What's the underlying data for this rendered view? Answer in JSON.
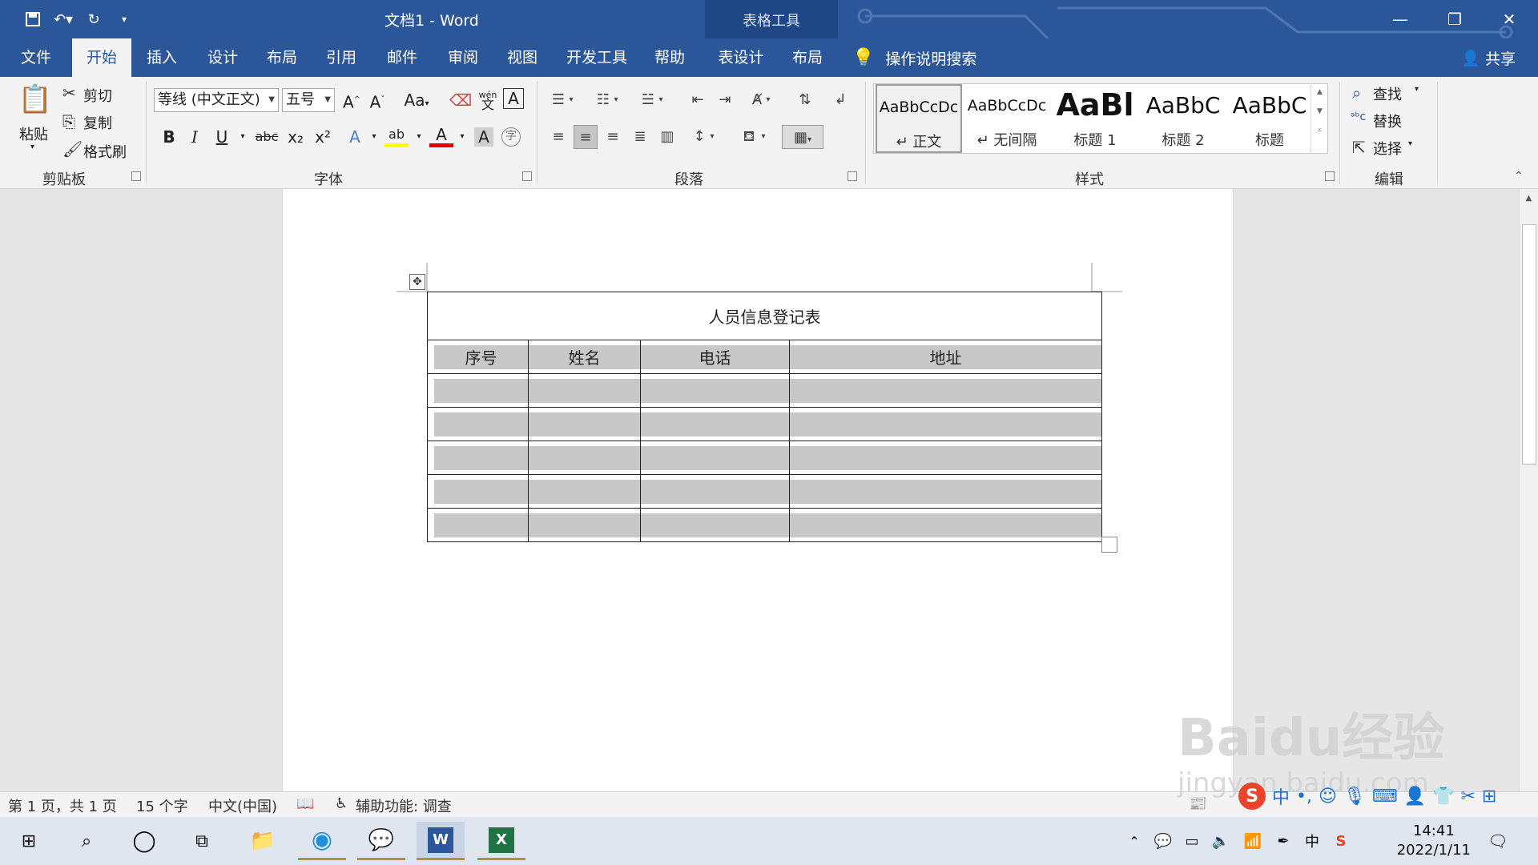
{
  "titlebar": {
    "doc_title": "文档1  -  Word",
    "tools_label": "表格工具"
  },
  "tabs": [
    "文件",
    "开始",
    "插入",
    "设计",
    "布局",
    "引用",
    "邮件",
    "审阅",
    "视图",
    "开发工具",
    "帮助",
    "表设计",
    "布局"
  ],
  "active_tab": "开始",
  "search": {
    "label": "操作说明搜索"
  },
  "share": {
    "label": "共享"
  },
  "clipboard": {
    "paste": "粘贴",
    "cut": "剪切",
    "copy": "复制",
    "format_painter": "格式刷",
    "label": "剪贴板"
  },
  "font": {
    "family": "等线 (中文正文)",
    "size": "五号",
    "label": "字体",
    "bold": "B",
    "italic": "I",
    "underline": "U",
    "strike": "abc",
    "grow": "A",
    "shrink": "A",
    "case": "Aa",
    "sub": "x₂",
    "sup": "x²",
    "effects": "A",
    "highlight": "ab",
    "color": "A",
    "shade": "A",
    "char_border": "A",
    "phonetic": "wén",
    "phonetic_sub": "文",
    "enclose": "字"
  },
  "paragraph": {
    "label": "段落"
  },
  "styles": {
    "label": "样式",
    "items": [
      {
        "sample": "AaBbCcDc",
        "name": "↵ 正文"
      },
      {
        "sample": "AaBbCcDc",
        "name": "↵ 无间隔"
      },
      {
        "sample": "AaBl",
        "name": "标题 1"
      },
      {
        "sample": "AaBbC",
        "name": "标题 2"
      },
      {
        "sample": "AaBbC",
        "name": "标题"
      }
    ]
  },
  "editing": {
    "label": "编辑",
    "find": "查找",
    "replace": "替换",
    "select": "选择"
  },
  "table": {
    "caption": "人员信息登记表",
    "headers": [
      "序号",
      "姓名",
      "电话",
      "地址"
    ],
    "empty_rows": 5
  },
  "status": {
    "page": "第 1 页，共 1 页",
    "words": "15 个字",
    "lang": "中文(中国)",
    "accessibility": "辅助功能: 调查"
  },
  "clock": {
    "time": "14:41",
    "date": "2022/1/11"
  },
  "tray": {
    "ime": "中"
  },
  "imebar": {
    "lang": "中"
  },
  "watermark": {
    "brand": "Baidu经验",
    "url": "jingyan.baidu.com"
  }
}
